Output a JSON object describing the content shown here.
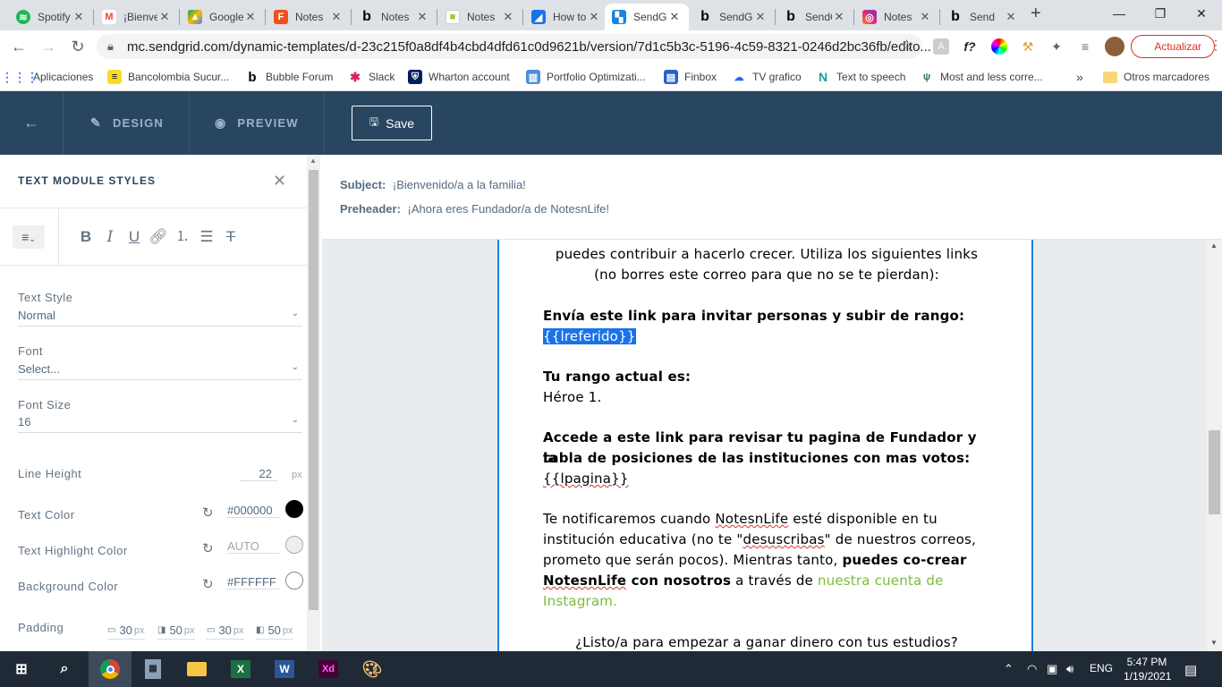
{
  "browser": {
    "tabs": [
      {
        "title": "Spotify",
        "icon": "spotify-icon",
        "color": "#1db954"
      },
      {
        "title": "¡Bienvenido",
        "icon": "gmail-icon",
        "color": "#ea4335"
      },
      {
        "title": "Google Drive",
        "icon": "drive-icon",
        "color": "#fbbc04"
      },
      {
        "title": "Notes",
        "icon": "figma-icon",
        "color": "#f24e1e"
      },
      {
        "title": "Notes",
        "icon": "bubble-icon",
        "color": "#000000"
      },
      {
        "title": "Notes",
        "icon": "notes-icon",
        "color": "#9acd32"
      },
      {
        "title": "How to",
        "icon": "doc-icon",
        "color": "#1a73e8"
      },
      {
        "title": "SendGrid",
        "icon": "sendgrid-icon",
        "color": "#1a82e2"
      },
      {
        "title": "SendGrid",
        "icon": "bubble-icon",
        "color": "#000000"
      },
      {
        "title": "SendGrid",
        "icon": "bubble-icon",
        "color": "#000000"
      },
      {
        "title": "Notes",
        "icon": "instagram-icon",
        "color": "#e1306c"
      },
      {
        "title": "Send",
        "icon": "bubble-icon",
        "color": "#000000"
      }
    ],
    "new_tab": "+",
    "url": "mc.sendgrid.com/dynamic-templates/d-23c215f0a8df4b4cbd4dfd61c0d9621b/version/7d1c5b3c-5196-4c59-8321-0246d2bc36fb/edito...",
    "update_label": "Actualizar",
    "bookmarks": [
      {
        "label": "Aplicaciones",
        "icon": "apps-grid-icon"
      },
      {
        "label": "Bancolombia Sucur...",
        "icon": "bancolombia-icon"
      },
      {
        "label": "Bubble Forum",
        "icon": "bubble-icon"
      },
      {
        "label": "Slack",
        "icon": "slack-icon"
      },
      {
        "label": "Wharton account",
        "icon": "wharton-icon"
      },
      {
        "label": "Portfolio Optimizati...",
        "icon": "chart-icon"
      },
      {
        "label": "Finbox",
        "icon": "finbox-icon"
      },
      {
        "label": "TV grafico",
        "icon": "tradingview-icon"
      },
      {
        "label": "Text to speech",
        "icon": "speech-icon"
      },
      {
        "label": "Most and less corre...",
        "icon": "plant-icon"
      }
    ],
    "bookmarks_more": "»",
    "other_bookmarks": "Otros marcadores"
  },
  "editor": {
    "tab_design": "DESIGN",
    "tab_preview": "PREVIEW",
    "save_label": "Save"
  },
  "panel": {
    "title": "TEXT MODULE STYLES",
    "text_style_label": "Text Style",
    "text_style_value": "Normal",
    "font_label": "Font",
    "font_value": "Select...",
    "font_size_label": "Font Size",
    "font_size_value": "16",
    "line_height_label": "Line Height",
    "line_height_value": "22",
    "line_height_unit": "px",
    "text_color_label": "Text Color",
    "text_color_value": "#000000",
    "highlight_label": "Text Highlight Color",
    "highlight_value": "AUTO",
    "bg_color_label": "Background Color",
    "bg_color_value": "#FFFFFF",
    "padding_label": "Padding",
    "padding": [
      {
        "value": "30",
        "unit": "px"
      },
      {
        "value": "50",
        "unit": "px"
      },
      {
        "value": "30",
        "unit": "px"
      },
      {
        "value": "50",
        "unit": "px"
      }
    ]
  },
  "email": {
    "subject_label": "Subject:",
    "subject_value": "¡Bienvenido/a a la familia!",
    "preheader_label": "Preheader:",
    "preheader_value": "¡Ahora eres Fundador/a de NotesnLife!",
    "line1": "puedes contribuir a hacerlo crecer. Utiliza los siguientes links",
    "line2": "(no borres este correo para que no se te pierdan):",
    "invite_heading": "Envía este link para invitar personas y subir de rango:",
    "invite_token": "{{lreferido}}",
    "rank_heading": "Tu rango actual es:",
    "rank_value": "Héroe 1.",
    "page_heading_1": "Accede a este link para revisar tu pagina de Fundador y la",
    "page_heading_2": "tabla de posiciones de las instituciones con mas votos:",
    "page_token": "{{lpagina}}",
    "notify_1a": "Te notificaremos cuando ",
    "notify_1b": "NotesnLife",
    "notify_1c": " esté disponible en tu",
    "notify_2a": "institución educativa (no te \"",
    "notify_2b": "desuscribas",
    "notify_2c": "\" de nuestros correos,",
    "notify_3a": "prometo que serán pocos). Mientras tanto, ",
    "notify_3b": "puedes co-crear",
    "notify_4a": "NotesnLife",
    "notify_4b": " con nosotros",
    "notify_4c": " a través de ",
    "notify_4d": "nuestra cuenta de",
    "notify_5": "Instagram.",
    "closing": "¿Listo/a para empezar a ganar dinero con tus estudios?"
  },
  "taskbar": {
    "apps": [
      "chrome-icon",
      "calculator-icon",
      "file-explorer-icon",
      "excel-icon",
      "word-icon",
      "xd-icon",
      "paint-icon"
    ],
    "lang": "ENG",
    "time": "5:47 PM",
    "date": "1/19/2021"
  },
  "colors": {
    "header_bg": "#294661",
    "accent_blue": "#1a82e2",
    "link_green": "#7dbb3c",
    "update_red": "#d93025"
  }
}
